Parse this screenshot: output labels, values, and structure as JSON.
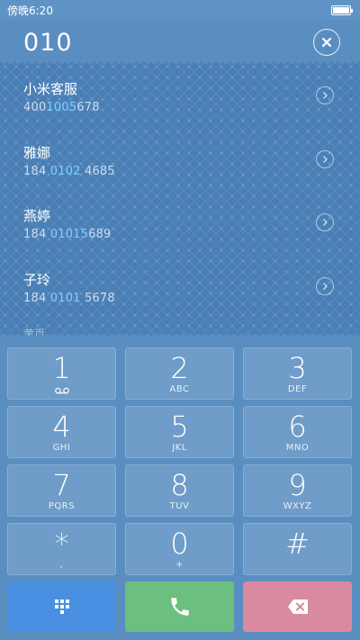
{
  "status_bar": {
    "time": "傍晚6:20",
    "battery_level": 1.0
  },
  "header": {
    "dial_number": "010"
  },
  "results": [
    {
      "name": "小米客服",
      "number_before": "400",
      "number_match": "1005",
      "number_after": "678"
    },
    {
      "name": "雅娜",
      "number_before": "184 ",
      "number_match": "0102",
      "number_after": " 4685"
    },
    {
      "name": "燕婷",
      "number_before": "184 ",
      "number_match": "01015",
      "number_after": "689"
    },
    {
      "name": "子玲",
      "number_before": "184 ",
      "number_match": "0101",
      "number_after": " 5678"
    }
  ],
  "more_label": "黄页",
  "keypad": [
    {
      "digit": "1",
      "letters": ""
    },
    {
      "digit": "2",
      "letters": "ABC"
    },
    {
      "digit": "3",
      "letters": "DEF"
    },
    {
      "digit": "4",
      "letters": "GHI"
    },
    {
      "digit": "5",
      "letters": "JKL"
    },
    {
      "digit": "6",
      "letters": "MNO"
    },
    {
      "digit": "7",
      "letters": "PQRS"
    },
    {
      "digit": "8",
      "letters": "TUV"
    },
    {
      "digit": "9",
      "letters": "WXYZ"
    },
    {
      "digit": "*",
      "letters": ","
    },
    {
      "digit": "0",
      "letters": "+"
    },
    {
      "digit": "#",
      "letters": ""
    }
  ],
  "colors": {
    "keypad_button": "#4a90e2",
    "call_button": "#6bbf7f",
    "delete_button": "#d98aa0"
  },
  "icons": {
    "clear": "close-icon",
    "voicemail": "voicemail-icon",
    "keypad_toggle": "dialpad-icon",
    "call": "phone-icon",
    "delete": "backspace-icon",
    "result_detail": "chevron-right-icon"
  }
}
